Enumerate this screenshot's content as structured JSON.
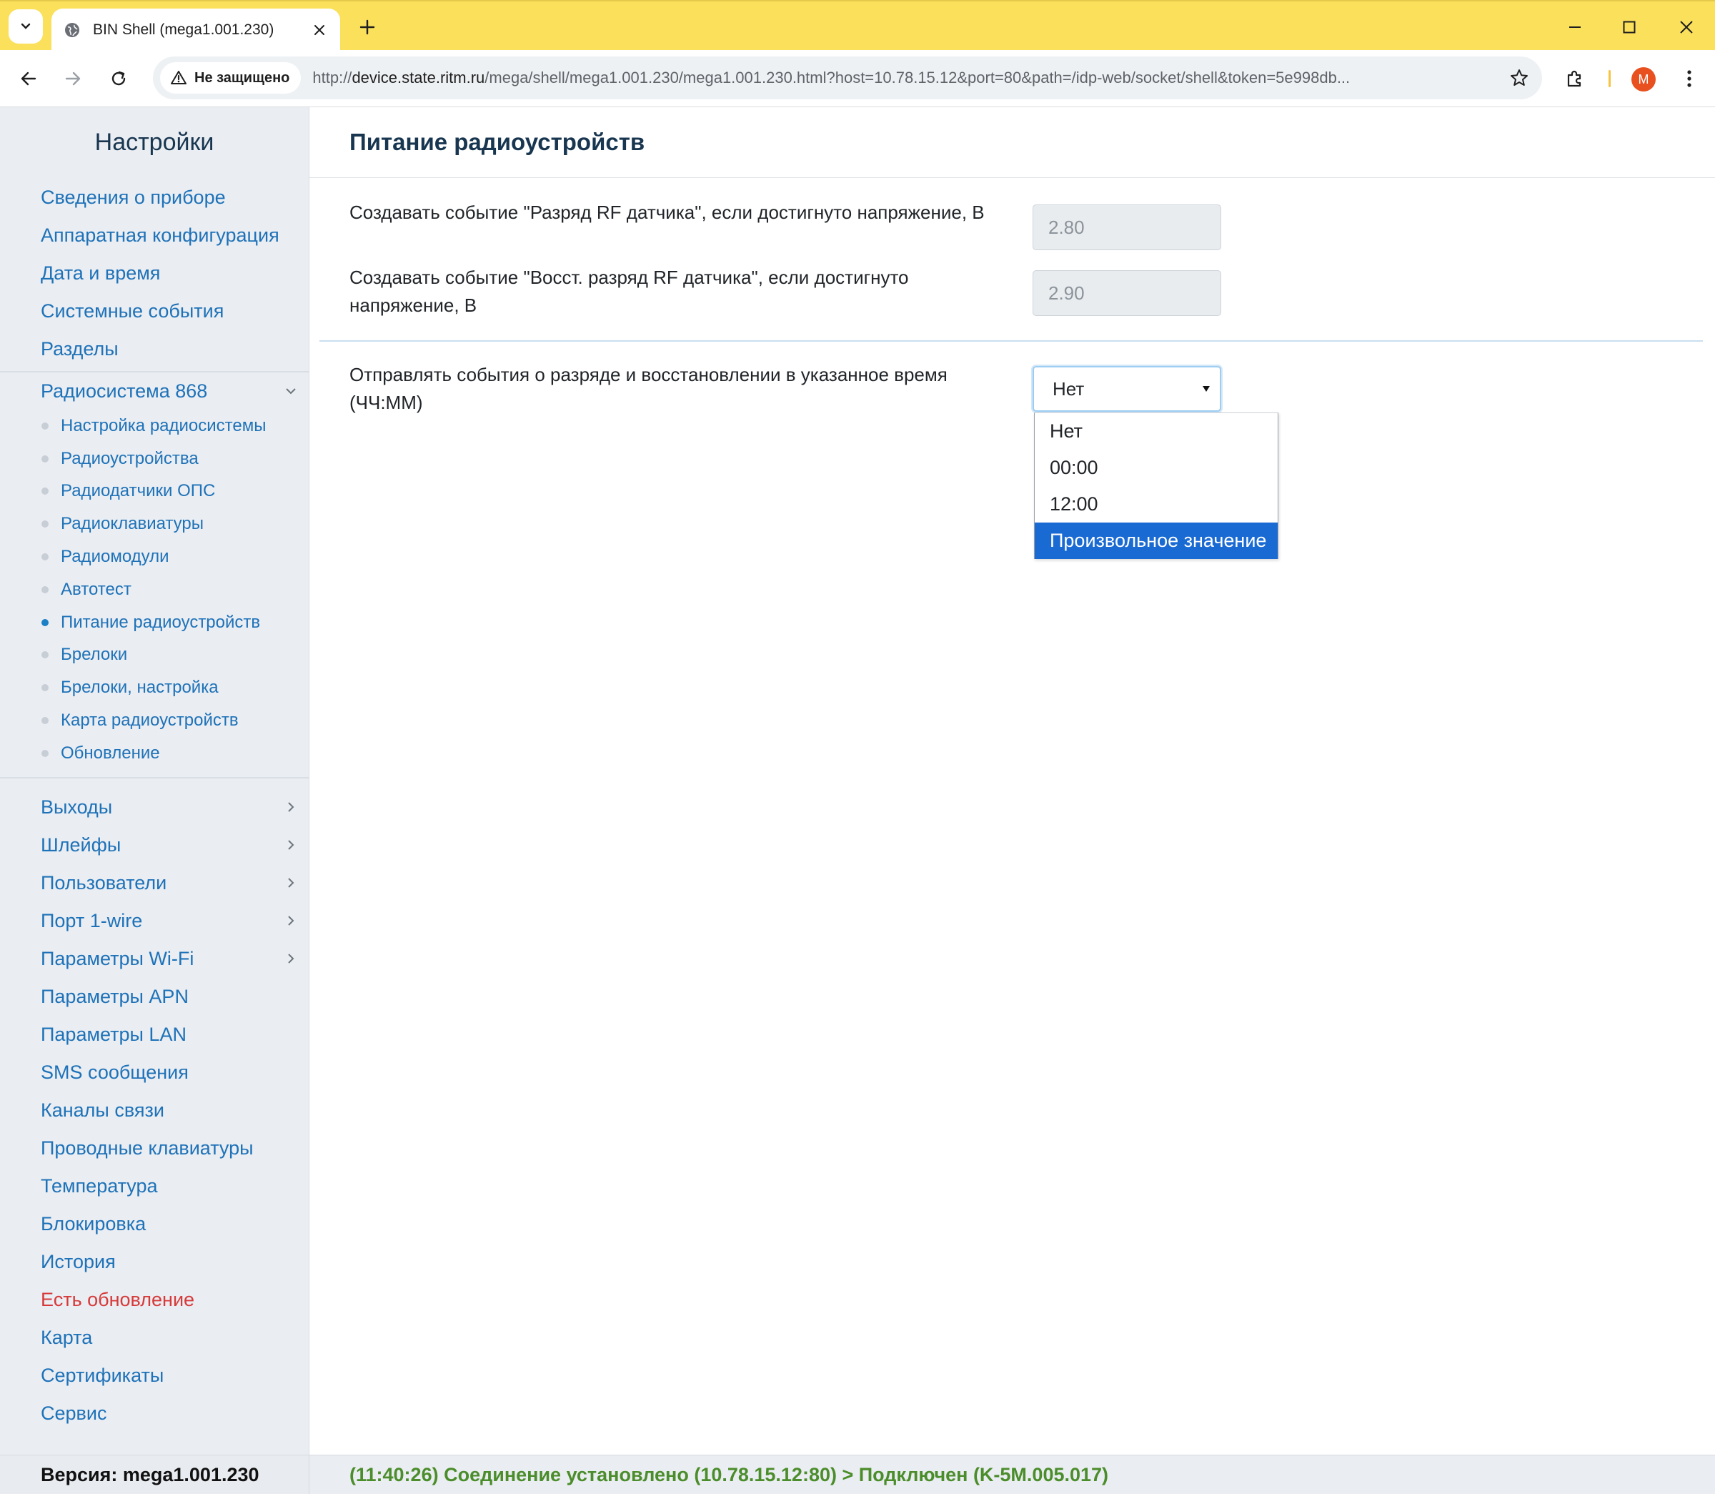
{
  "browser": {
    "tab_title": "BIN Shell (mega1.001.230)",
    "security_label": "Не защищено",
    "url_scheme": "http://",
    "url_host": "device.state.ritm.ru",
    "url_rest": "/mega/shell/mega1.001.230/mega1.001.230.html?host=10.78.15.12&port=80&path=/idp-web/socket/shell&token=5e998db...",
    "profile_initial": "M",
    "titlebar_color": "#fbe05c"
  },
  "sidebar": {
    "title": "Настройки",
    "top_items": [
      {
        "label": "Сведения о приборе"
      },
      {
        "label": "Аппаратная конфигурация"
      },
      {
        "label": "Дата и время"
      },
      {
        "label": "Системные события"
      },
      {
        "label": "Разделы"
      }
    ],
    "expanded_item": {
      "label": "Радиосистема 868",
      "icon": "chevron-down-icon"
    },
    "sub_items": [
      {
        "label": "Настройка радиосистемы"
      },
      {
        "label": "Радиоустройства"
      },
      {
        "label": "Радиодатчики ОПС"
      },
      {
        "label": "Радиоклавиатуры"
      },
      {
        "label": "Радиомодули"
      },
      {
        "label": "Автотест"
      },
      {
        "label": "Питание радиоустройств",
        "active": true
      },
      {
        "label": "Брелоки"
      },
      {
        "label": "Брелоки, настройка"
      },
      {
        "label": "Карта радиоустройств"
      },
      {
        "label": "Обновление"
      }
    ],
    "bottom_items": [
      {
        "label": "Выходы",
        "has_children": true
      },
      {
        "label": "Шлейфы",
        "has_children": true
      },
      {
        "label": "Пользователи",
        "has_children": true
      },
      {
        "label": "Порт 1-wire",
        "has_children": true
      },
      {
        "label": "Параметры Wi-Fi",
        "has_children": true
      },
      {
        "label": "Параметры APN"
      },
      {
        "label": "Параметры LAN"
      },
      {
        "label": "SMS сообщения"
      },
      {
        "label": "Каналы связи"
      },
      {
        "label": "Проводные клавиатуры"
      },
      {
        "label": "Температура"
      },
      {
        "label": "Блокировка"
      },
      {
        "label": "История"
      },
      {
        "label": "Есть обновление",
        "alert": true
      },
      {
        "label": "Карта"
      },
      {
        "label": "Сертификаты"
      },
      {
        "label": "Сервис"
      }
    ],
    "version": "Версия: mega1.001.230"
  },
  "main": {
    "title": "Питание радиоустройств",
    "field1": {
      "label": "Создавать событие \"Разряд RF датчика\", если достигнуто напряжение, В",
      "value": "2.80"
    },
    "field2": {
      "label": "Создавать событие \"Восст. разряд RF датчика\", если достигнуто напряжение, В",
      "value": "2.90"
    },
    "field3": {
      "label": "Отправлять события о разряде и восстановлении в указанное время (ЧЧ:ММ)",
      "selected": "Нет",
      "options": [
        "Нет",
        "00:00",
        "12:00",
        "Произвольное значение"
      ],
      "highlighted_index": 3
    }
  },
  "status": {
    "text": "(11:40:26) Соединение установлено (10.78.15.12:80) > Подключен (K-5M.005.017)",
    "color": "#4b8d2b"
  },
  "colors": {
    "link": "#1e72b8",
    "alert": "#d63a3a",
    "heading": "#183650",
    "selection": "#1a6ad4"
  }
}
